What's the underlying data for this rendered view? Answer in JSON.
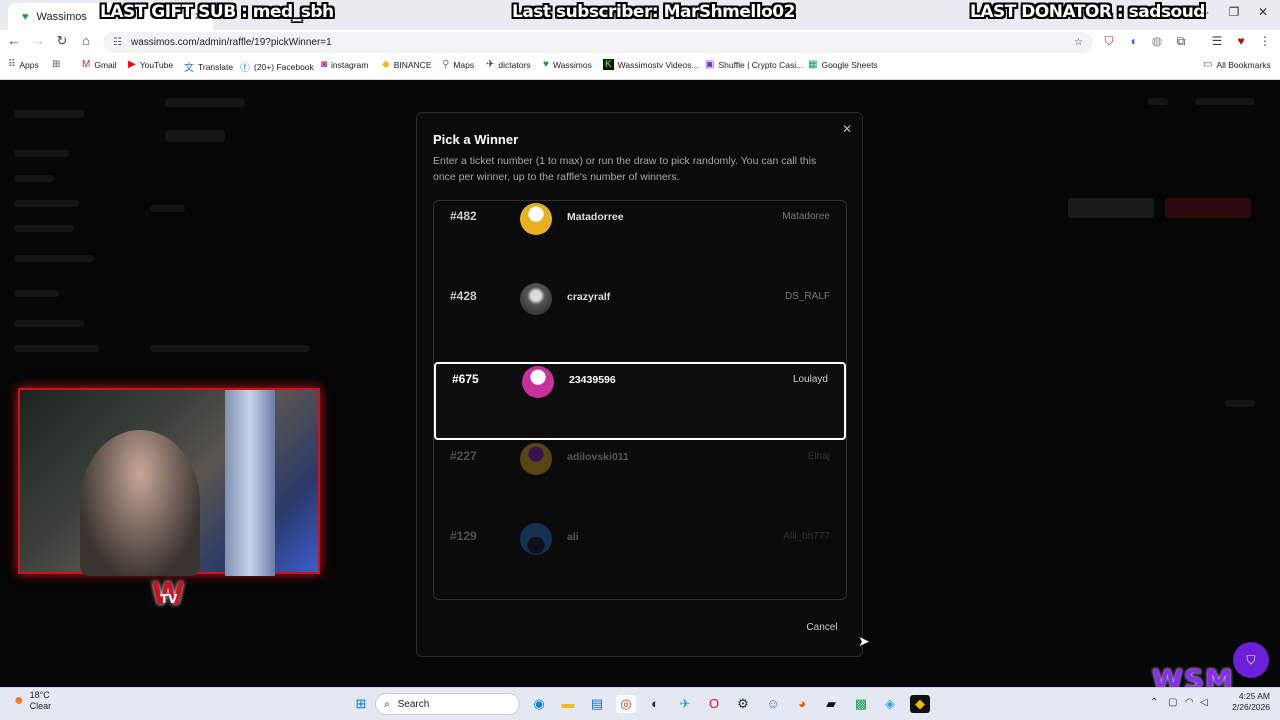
{
  "browser": {
    "tab_title": "Wassimos",
    "url": "wassimos.com/admin/raffle/19?pickWinner=1",
    "all_bookmarks": "All Bookmarks"
  },
  "stream_overlay": {
    "last_gift_sub": "LAST GIFT SUB : med_sbh",
    "last_subscriber": "Last subscriber: MarShmello02",
    "last_donator": "LAST DONATOR : sadsoud"
  },
  "bookmarks": [
    {
      "label": "Apps",
      "icon": "apps-grid-icon"
    },
    {
      "label": "Gmail",
      "icon": "gmail-icon"
    },
    {
      "label": "YouTube",
      "icon": "youtube-icon"
    },
    {
      "label": "Translate",
      "icon": "translate-icon"
    },
    {
      "label": "(20+) Facebook",
      "icon": "facebook-icon"
    },
    {
      "label": "instagram",
      "icon": "instagram-icon"
    },
    {
      "label": "BINANCE",
      "icon": "binance-icon"
    },
    {
      "label": "Maps",
      "icon": "maps-icon"
    },
    {
      "label": "dictators",
      "icon": "dictators-icon"
    },
    {
      "label": "Wassimos",
      "icon": "wassimos-icon"
    },
    {
      "label": "Wassimostv Videos...",
      "icon": "kick-icon"
    },
    {
      "label": "Shuffle | Crypto Casi...",
      "icon": "shuffle-icon"
    },
    {
      "label": "Google Sheets",
      "icon": "sheets-icon"
    }
  ],
  "modal": {
    "title": "Pick a Winner",
    "description": "Enter a ticket number (1 to max) or run the draw to pick randomly. You can call this once per winner, up to the raffle's number of winners.",
    "cancel_label": "Cancel",
    "entries": [
      {
        "ticket": "#482",
        "username": "Matadorree",
        "alt_name": "Matadoree",
        "avatar_color": "#e8b020",
        "state": "normal"
      },
      {
        "ticket": "#428",
        "username": "crazyralf",
        "alt_name": "DS_RALF",
        "avatar_color": "#5a5a5a",
        "state": "normal"
      },
      {
        "ticket": "#675",
        "username": "23439596",
        "alt_name": "Loulayd",
        "avatar_color": "#c8309a",
        "state": "selected"
      },
      {
        "ticket": "#227",
        "username": "adilovski011",
        "alt_name": "Elhaj",
        "avatar_color": "#e8b020",
        "state": "dimmed"
      },
      {
        "ticket": "#129",
        "username": "ali",
        "alt_name": "Alli_bh777",
        "avatar_color": "#2a7ad0",
        "state": "dimmed"
      }
    ]
  },
  "webcam_logo": {
    "letter": "W",
    "sub": "TV"
  },
  "wsm_logo": "WSM",
  "taskbar": {
    "weather_temp": "18°C",
    "weather_desc": "Clear",
    "search_placeholder": "Search",
    "time": "4:25 AM",
    "date": "2/26/2026"
  }
}
